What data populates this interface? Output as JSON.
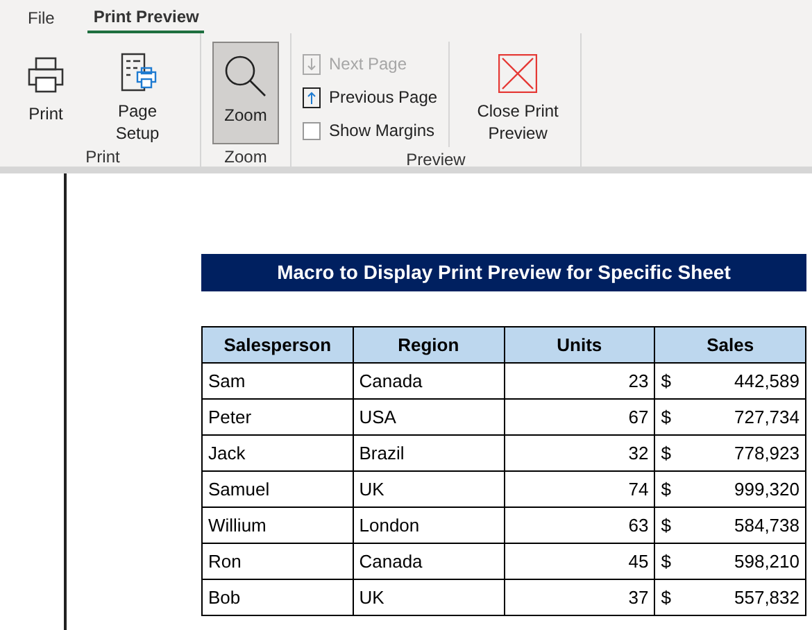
{
  "tabs": [
    {
      "label": "File",
      "selected": false
    },
    {
      "label": "Print Preview",
      "selected": true
    }
  ],
  "groups": [
    {
      "label": "Print",
      "items": [
        {
          "kind": "large",
          "label": "Print",
          "pressed": false
        },
        {
          "kind": "large",
          "label": "Page Setup",
          "pressed": false
        }
      ]
    },
    {
      "label": "Zoom",
      "items": [
        {
          "kind": "large",
          "label": "Zoom",
          "pressed": true
        }
      ]
    },
    {
      "label": "Preview",
      "items": [
        {
          "kind": "small",
          "label": "Next Page",
          "disabled": true
        },
        {
          "kind": "small",
          "label": "Previous Page",
          "disabled": false
        },
        {
          "kind": "check",
          "label": "Show Margins",
          "checked": false
        },
        {
          "kind": "large",
          "label": "Close Print Preview",
          "pressed": false
        }
      ]
    }
  ],
  "sheet": {
    "title": "Macro to Display Print Preview for Specific Sheet",
    "columns": [
      "Salesperson",
      "Region",
      "Units",
      "Sales"
    ],
    "rows": [
      [
        "Sam",
        "Canada",
        "23",
        {
          "currency": "$",
          "amount": "442,589"
        }
      ],
      [
        "Peter",
        "USA",
        "67",
        {
          "currency": "$",
          "amount": "727,734"
        }
      ],
      [
        "Jack",
        "Brazil",
        "32",
        {
          "currency": "$",
          "amount": "778,923"
        }
      ],
      [
        "Samuel",
        "UK",
        "74",
        {
          "currency": "$",
          "amount": "999,320"
        }
      ],
      [
        "Willium",
        "London",
        "63",
        {
          "currency": "$",
          "amount": "584,738"
        }
      ],
      [
        "Ron",
        "Canada",
        "45",
        {
          "currency": "$",
          "amount": "598,210"
        }
      ],
      [
        "Bob",
        "UK",
        "37",
        {
          "currency": "$",
          "amount": "557,832"
        }
      ]
    ]
  }
}
